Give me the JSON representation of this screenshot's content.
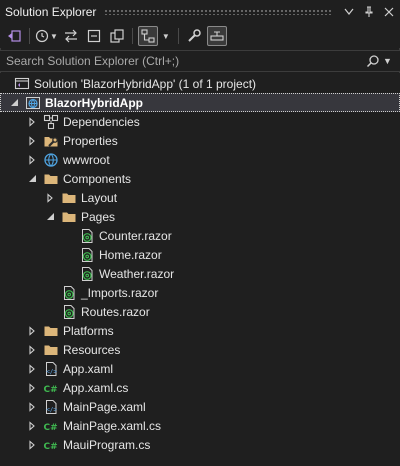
{
  "window": {
    "title": "Solution Explorer"
  },
  "search": {
    "placeholder": "Search Solution Explorer (Ctrl+;)"
  },
  "solution": {
    "label": "Solution 'BlazorHybridApp' (1 of 1 project)"
  },
  "tree": [
    {
      "label": "BlazorHybridApp",
      "icon": "web-project-icon",
      "level": 0,
      "expander": "expanded",
      "bold": true,
      "selected": true
    },
    {
      "label": "Dependencies",
      "icon": "dependencies-icon",
      "level": 1,
      "expander": "collapsed"
    },
    {
      "label": "Properties",
      "icon": "properties-icon",
      "level": 1,
      "expander": "collapsed"
    },
    {
      "label": "wwwroot",
      "icon": "globe-icon",
      "level": 1,
      "expander": "collapsed"
    },
    {
      "label": "Components",
      "icon": "folder-icon",
      "level": 1,
      "expander": "expanded"
    },
    {
      "label": "Layout",
      "icon": "folder-icon",
      "level": 2,
      "expander": "collapsed"
    },
    {
      "label": "Pages",
      "icon": "folder-icon",
      "level": 2,
      "expander": "expanded"
    },
    {
      "label": "Counter.razor",
      "icon": "razor-file-icon",
      "level": 3,
      "expander": "none"
    },
    {
      "label": "Home.razor",
      "icon": "razor-file-icon",
      "level": 3,
      "expander": "none"
    },
    {
      "label": "Weather.razor",
      "icon": "razor-file-icon",
      "level": 3,
      "expander": "none"
    },
    {
      "label": "_Imports.razor",
      "icon": "razor-file-icon",
      "level": 2,
      "expander": "none"
    },
    {
      "label": "Routes.razor",
      "icon": "razor-file-icon",
      "level": 2,
      "expander": "none"
    },
    {
      "label": "Platforms",
      "icon": "folder-icon",
      "level": 1,
      "expander": "collapsed"
    },
    {
      "label": "Resources",
      "icon": "folder-icon",
      "level": 1,
      "expander": "collapsed"
    },
    {
      "label": "App.xaml",
      "icon": "xaml-file-icon",
      "level": 1,
      "expander": "collapsed"
    },
    {
      "label": "App.xaml.cs",
      "icon": "csharp-file-icon",
      "level": 1,
      "expander": "collapsed"
    },
    {
      "label": "MainPage.xaml",
      "icon": "xaml-file-icon",
      "level": 1,
      "expander": "collapsed"
    },
    {
      "label": "MainPage.xaml.cs",
      "icon": "csharp-file-icon",
      "level": 1,
      "expander": "collapsed"
    },
    {
      "label": "MauiProgram.cs",
      "icon": "csharp-file-icon",
      "level": 1,
      "expander": "collapsed"
    }
  ],
  "colors": {
    "background": "#1f1f1f",
    "folder": "#dcb67a",
    "razor": "#3fb950",
    "csharp": "#3fb950",
    "globe": "#4fa3e0",
    "selection": "#37373d"
  }
}
